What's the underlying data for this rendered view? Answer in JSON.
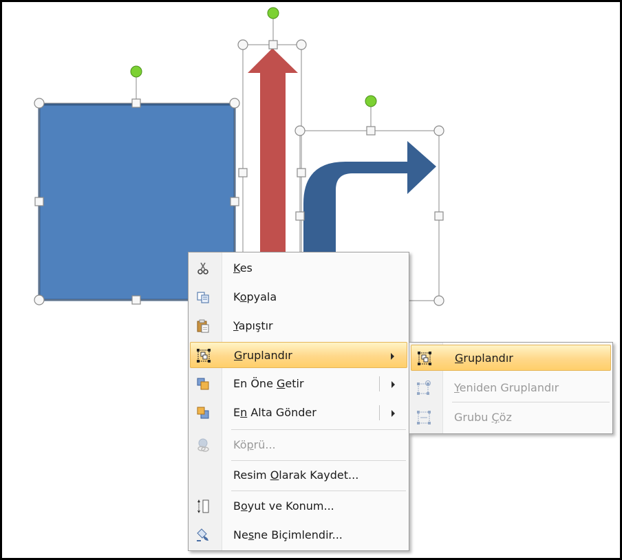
{
  "context_menu": {
    "items": [
      {
        "id": "cut",
        "label": "Kes",
        "accel": "K",
        "icon": "scissors-icon",
        "enabled": true
      },
      {
        "id": "copy",
        "label": "Kopyala",
        "accel": "o",
        "icon": "copy-icon",
        "enabled": true
      },
      {
        "id": "paste",
        "label": "Yapıştır",
        "accel": "Y",
        "icon": "paste-icon",
        "enabled": true
      },
      {
        "id": "group",
        "label": "Gruplandır",
        "accel": "G",
        "icon": "group-icon",
        "enabled": true,
        "has_submenu": true,
        "highlighted": true
      },
      {
        "id": "bring-to-front",
        "label": "En Öne Getir",
        "accel": "G",
        "icon": "bring-to-front-icon",
        "enabled": true,
        "has_submenu": true,
        "split": true
      },
      {
        "id": "send-to-back",
        "label": "En Alta Gönder",
        "accel": "n",
        "icon": "send-to-back-icon",
        "enabled": true,
        "has_submenu": true,
        "split": true
      },
      {
        "id": "hyperlink",
        "label": "Köprü...",
        "accel": "p",
        "icon": "hyperlink-icon",
        "enabled": false
      },
      {
        "id": "save-as-picture",
        "label": "Resim Olarak Kaydet...",
        "accel": "O",
        "icon": "",
        "enabled": true
      },
      {
        "id": "size-position",
        "label": "Boyut ve Konum...",
        "accel": "o",
        "icon": "size-position-icon",
        "enabled": true
      },
      {
        "id": "format-object",
        "label": "Nesne Biçimlendir...",
        "accel": "s",
        "icon": "format-object-icon",
        "enabled": true
      }
    ]
  },
  "submenu": {
    "items": [
      {
        "id": "group",
        "label": "Gruplandır",
        "accel": "G",
        "icon": "group-icon",
        "enabled": true,
        "highlighted": true
      },
      {
        "id": "regroup",
        "label": "Yeniden Gruplandır",
        "accel": "Y",
        "icon": "regroup-icon",
        "enabled": false
      },
      {
        "id": "ungroup",
        "label": "Grubu Çöz",
        "accel": "Ç",
        "icon": "ungroup-icon",
        "enabled": false
      }
    ]
  },
  "shapes": {
    "square_color": "#4f81bd",
    "square_border": "#385d8a",
    "up_arrow_color": "#c0504d",
    "bent_arrow_color": "#376092",
    "rotation_handle_color": "#7cd133"
  },
  "colors": {
    "highlight": "#ffd88a",
    "disabled_text": "#9a9a9a"
  }
}
